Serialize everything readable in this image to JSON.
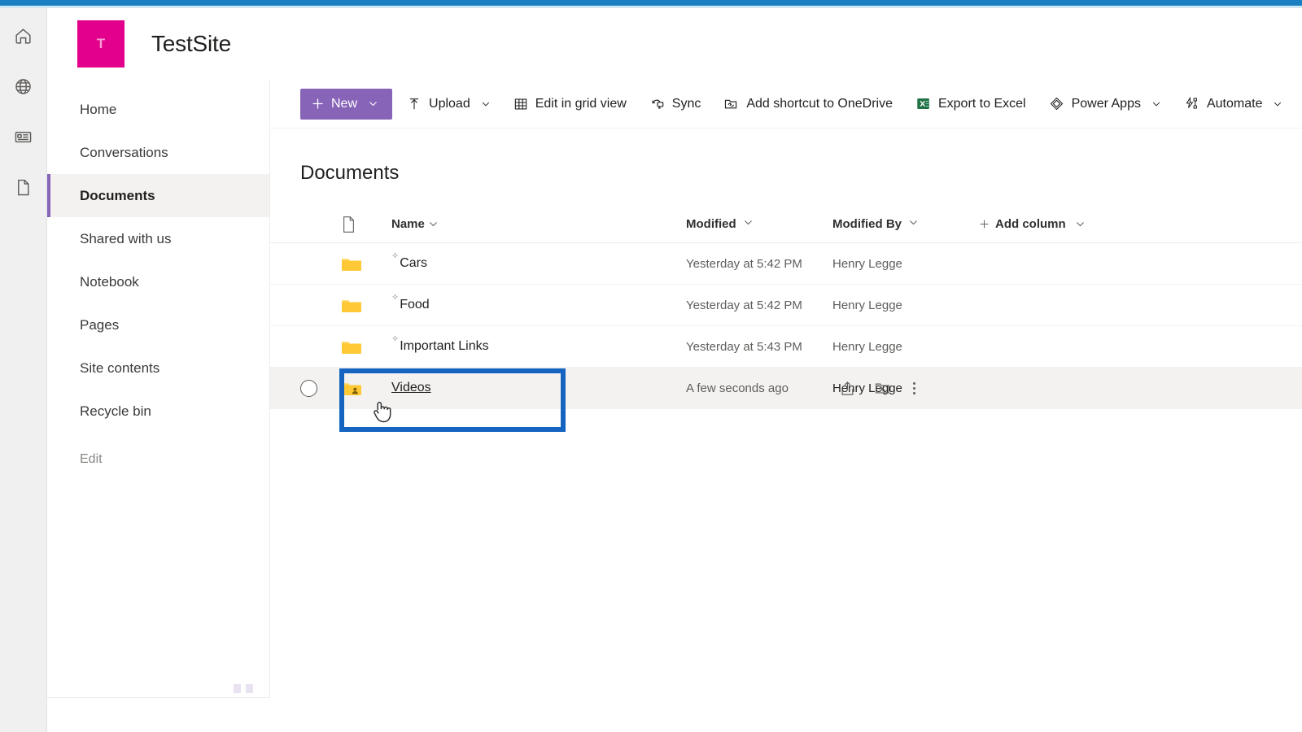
{
  "site": {
    "logo_letter": "T",
    "title": "TestSite",
    "logo_color": "#e3008c",
    "accent_color": "#8764b8",
    "topbar_color": "#1a7fc1"
  },
  "rail": {
    "items": [
      {
        "icon": "home-icon",
        "label": "Home"
      },
      {
        "icon": "globe-icon",
        "label": "Web"
      },
      {
        "icon": "news-icon",
        "label": "News"
      },
      {
        "icon": "document-icon",
        "label": "Documents"
      }
    ]
  },
  "sidebar": {
    "items": [
      {
        "label": "Home",
        "active": false
      },
      {
        "label": "Conversations",
        "active": false
      },
      {
        "label": "Documents",
        "active": true
      },
      {
        "label": "Shared with us",
        "active": false
      },
      {
        "label": "Notebook",
        "active": false
      },
      {
        "label": "Pages",
        "active": false
      },
      {
        "label": "Site contents",
        "active": false
      },
      {
        "label": "Recycle bin",
        "active": false
      }
    ],
    "edit_label": "Edit"
  },
  "toolbar": {
    "new_label": "New",
    "upload_label": "Upload",
    "grid_label": "Edit in grid view",
    "sync_label": "Sync",
    "shortcut_label": "Add shortcut to OneDrive",
    "excel_label": "Export to Excel",
    "powerapps_label": "Power Apps",
    "automate_label": "Automate",
    "excel_icon_color": "#217346"
  },
  "main": {
    "title": "Documents",
    "columns": {
      "name": "Name",
      "modified": "Modified",
      "modified_by": "Modified By",
      "add_column": "Add column"
    },
    "rows": [
      {
        "name": "Cars",
        "modified": "Yesterday at 5:42 PM",
        "modified_by": "Henry Legge",
        "icon": "folder-icon",
        "selected": false,
        "shared": false
      },
      {
        "name": "Food",
        "modified": "Yesterday at 5:42 PM",
        "modified_by": "Henry Legge",
        "icon": "folder-icon",
        "selected": false,
        "shared": false
      },
      {
        "name": "Important Links",
        "modified": "Yesterday at 5:43 PM",
        "modified_by": "Henry Legge",
        "icon": "folder-icon",
        "selected": false,
        "shared": false
      },
      {
        "name": "Videos",
        "modified": "A few seconds ago",
        "modified_by": "Henry Legge",
        "icon": "folder-shared-icon",
        "selected": true,
        "shared": true
      }
    ]
  },
  "annotation": {
    "color": "#1565c0",
    "target": "Videos"
  }
}
